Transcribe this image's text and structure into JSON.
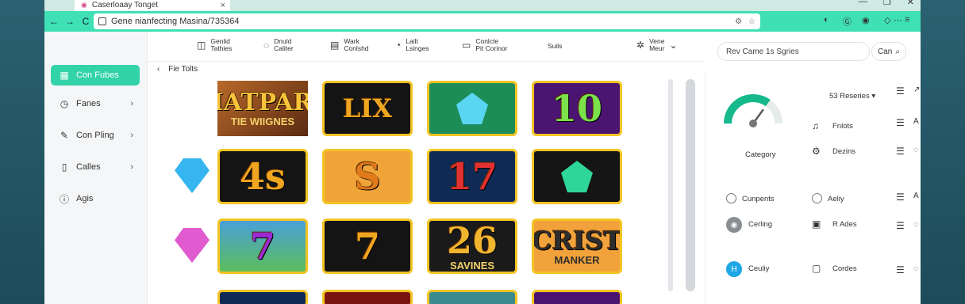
{
  "window": {
    "tab_title": "Caserloaay Tonget",
    "close_glyph": "×",
    "controls": [
      "—",
      "❐",
      "✕"
    ]
  },
  "nav": {
    "back": "←",
    "forward": "→",
    "reload": "C",
    "url": "Gene nianfecting Masina/735364",
    "star": "☆",
    "extensions": [
      "◐",
      "Ⓖ",
      "◉",
      "◇",
      "⋯",
      "≡"
    ]
  },
  "sidebar": {
    "items": [
      {
        "label": "Con Fubes",
        "icon": "grid-icon",
        "glyph": "▦",
        "active": true,
        "chevron": ""
      },
      {
        "label": "Fanes",
        "icon": "clock-icon",
        "glyph": "◷",
        "active": false,
        "chevron": "›"
      },
      {
        "label": "Con Pling",
        "icon": "pen-icon",
        "glyph": "✎",
        "active": false,
        "chevron": "›"
      },
      {
        "label": "Calles",
        "icon": "book-icon",
        "glyph": "▯",
        "active": false,
        "chevron": "›"
      },
      {
        "label": "Agis",
        "icon": "info-icon",
        "glyph": "ⓘ",
        "active": false,
        "chevron": ""
      }
    ]
  },
  "toolbar": {
    "items": [
      {
        "line1": "Genlid",
        "line2": "Tathies",
        "glyph": "◫"
      },
      {
        "line1": "Dnuld",
        "line2": "Caliter",
        "glyph": "◌"
      },
      {
        "line1": "Wark",
        "line2": "Conlshd",
        "glyph": "▤"
      },
      {
        "line1": "Lailt",
        "line2": "Lsinges",
        "glyph": "◔"
      },
      {
        "line1": "Conlcte",
        "line2": "Pit Corinor",
        "glyph": "▭"
      },
      {
        "line1": "Suils",
        "line2": "",
        "glyph": ""
      },
      {
        "line1": "Vene",
        "line2": "Meur",
        "glyph": "✲"
      }
    ],
    "dropdown": "⌄"
  },
  "breadcrumb": {
    "back": "‹",
    "label": "Fie Tolts"
  },
  "games": [
    {
      "row": 0,
      "col": 0,
      "text": "SIATPART",
      "sub": "TIE WIIGNES",
      "theme": "title"
    },
    {
      "row": 0,
      "col": 1,
      "text": "LIX",
      "theme": "dark"
    },
    {
      "row": 0,
      "col": 2,
      "text": "",
      "theme": "green-gem"
    },
    {
      "row": 0,
      "col": 3,
      "text": "10",
      "theme": "purple"
    },
    {
      "row": 1,
      "col": 0,
      "text": "4s",
      "theme": "dark"
    },
    {
      "row": 1,
      "col": 1,
      "text": "S",
      "theme": "orange"
    },
    {
      "row": 1,
      "col": 2,
      "text": "17",
      "theme": "navy"
    },
    {
      "row": 1,
      "col": 3,
      "text": "",
      "theme": "emerald"
    },
    {
      "row": 2,
      "col": 0,
      "text": "7",
      "theme": "meadow"
    },
    {
      "row": 2,
      "col": 1,
      "text": "7",
      "theme": "dark"
    },
    {
      "row": 2,
      "col": 2,
      "text": "26",
      "sub": "SAVINES",
      "theme": "dark-gold"
    },
    {
      "row": 2,
      "col": 3,
      "text": "CRIST",
      "sub": "MANKER",
      "theme": "orange-title"
    },
    {
      "row": 3,
      "col": 0,
      "text": "",
      "theme": "navy"
    },
    {
      "row": 3,
      "col": 1,
      "text": "",
      "theme": "red"
    },
    {
      "row": 3,
      "col": 2,
      "text": "",
      "theme": "teal"
    },
    {
      "row": 3,
      "col": 3,
      "text": "",
      "theme": "purple"
    }
  ],
  "side_gems": [
    {
      "color": "#36b6f0",
      "row": 1
    },
    {
      "color": "#e05ad0",
      "row": 2
    }
  ],
  "right_panel": {
    "search_placeholder": "Rev Came 1s Sgries",
    "search_button": "Can",
    "gauge_level": 0.7,
    "gauge_label": "Category",
    "series_dropdown": "53 Reseries",
    "stats": [
      {
        "label": "Fnlots",
        "icon": "music-icon",
        "glyph": "♫"
      },
      {
        "label": "Dezins",
        "icon": "settings-icon",
        "glyph": "⚙"
      }
    ],
    "options_left": [
      {
        "label": "Cunpents",
        "kind": "radio"
      },
      {
        "label": "Cerling",
        "kind": "grey"
      },
      {
        "label": "Ceuliy",
        "kind": "blue"
      }
    ],
    "options_right": [
      {
        "label": "Aeliy",
        "kind": "radio"
      },
      {
        "label": "R Ades",
        "kind": "box"
      },
      {
        "label": "Cordes",
        "kind": "box2"
      }
    ],
    "column_glyph": "☰",
    "edge_glyphs": [
      "↗",
      "A",
      "◌",
      "A",
      "◌",
      "◌",
      "◌"
    ]
  },
  "colors": {
    "accent": "#32d3a8",
    "tile_border": "#f3c424",
    "nav_bar": "#3fe0b5",
    "blue_dot": "#1ea7e6"
  }
}
